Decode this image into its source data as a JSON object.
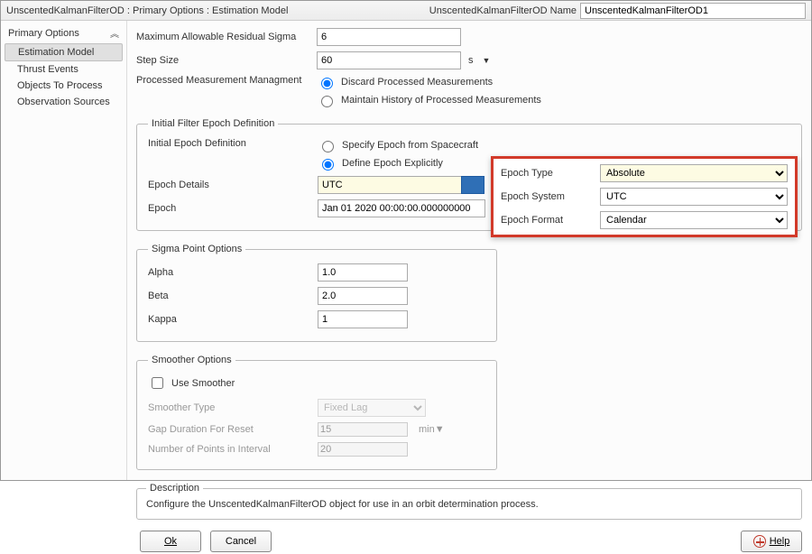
{
  "title_crumb": "UnscentedKalmanFilterOD : Primary Options : Estimation Model",
  "name_label": "UnscentedKalmanFilterOD Name",
  "name_value": "UnscentedKalmanFilterOD1",
  "sidebar": {
    "header": "Primary Options",
    "items": [
      {
        "label": "Estimation Model",
        "selected": true
      },
      {
        "label": "Thrust Events",
        "selected": false
      },
      {
        "label": "Objects To Process",
        "selected": false
      },
      {
        "label": "Observation Sources",
        "selected": false
      }
    ]
  },
  "fields": {
    "max_sigma_label": "Maximum Allowable Residual Sigma",
    "max_sigma_value": "6",
    "step_size_label": "Step Size",
    "step_size_value": "60",
    "step_size_unit": "s",
    "pmm_label": "Processed Measurement Managment",
    "pmm_option1": "Discard Processed Measurements",
    "pmm_option2": "Maintain History of Processed Measurements"
  },
  "initial_epoch": {
    "legend": "Initial Filter Epoch Definition",
    "def_label": "Initial Epoch Definition",
    "def_option1": "Specify Epoch from Spacecraft",
    "def_option2": "Define Epoch Explicitly",
    "details_label": "Epoch Details",
    "details_value": "UTC",
    "epoch_label": "Epoch",
    "epoch_value": "Jan 01 2020 00:00:00.000000000"
  },
  "sigma": {
    "legend": "Sigma Point Options",
    "alpha_label": "Alpha",
    "alpha_value": "1.0",
    "beta_label": "Beta",
    "beta_value": "2.0",
    "kappa_label": "Kappa",
    "kappa_value": "1"
  },
  "smoother": {
    "legend": "Smoother Options",
    "use_label": "Use Smoother",
    "use_checked": false,
    "type_label": "Smoother Type",
    "type_value": "Fixed Lag",
    "gap_label": "Gap Duration For Reset",
    "gap_value": "15",
    "gap_unit": "min",
    "npts_label": "Number of Points in Interval",
    "npts_value": "20"
  },
  "description": {
    "legend": "Description",
    "text": "Configure the UnscentedKalmanFilterOD object for use in an orbit determination process."
  },
  "buttons": {
    "ok": "Ok",
    "cancel": "Cancel",
    "help": "Help"
  },
  "callout": {
    "epoch_type_label": "Epoch Type",
    "epoch_type_value": "Absolute",
    "epoch_system_label": "Epoch System",
    "epoch_system_value": "UTC",
    "epoch_format_label": "Epoch Format",
    "epoch_format_value": "Calendar"
  }
}
